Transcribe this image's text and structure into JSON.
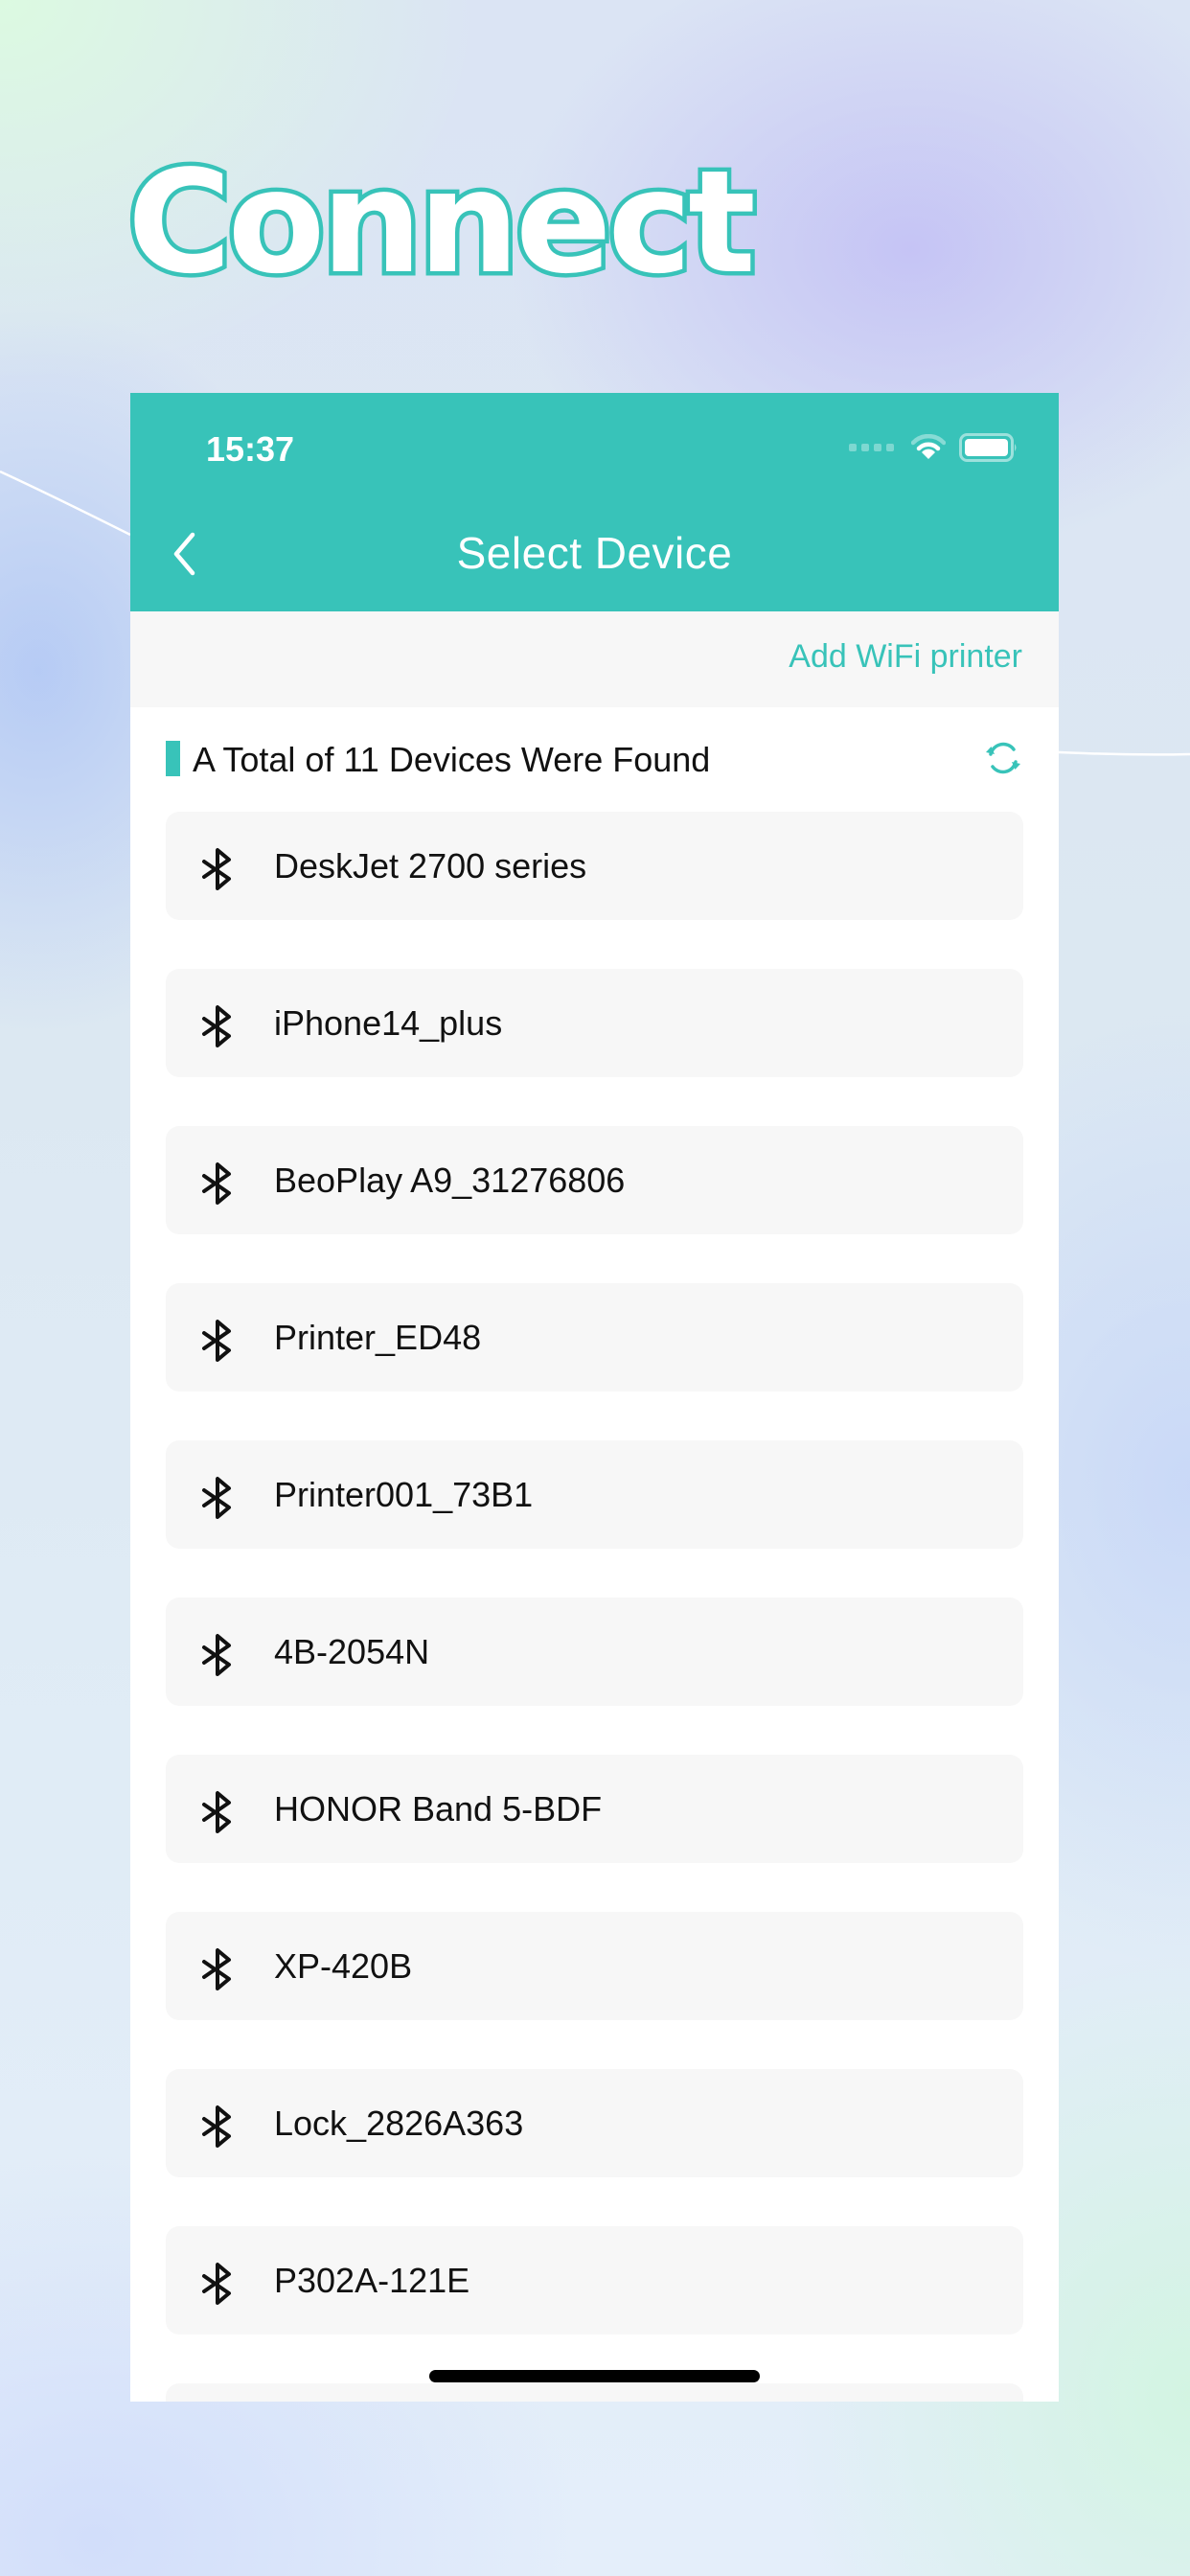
{
  "headline": "Connect",
  "status_bar": {
    "time": "15:37",
    "icons": [
      "signal-dots-icon",
      "wifi-icon",
      "battery-icon"
    ]
  },
  "nav": {
    "back_icon": "chevron-left-icon",
    "title": "Select Device"
  },
  "actions": {
    "add_wifi_label": "Add WiFi printer"
  },
  "section": {
    "title": "A Total of 11 Devices Were Found",
    "refresh_icon": "refresh-icon"
  },
  "devices": [
    {
      "name": "DeskJet 2700 series",
      "icon": "bluetooth-icon"
    },
    {
      "name": "iPhone14_plus",
      "icon": "bluetooth-icon"
    },
    {
      "name": "BeoPlay A9_31276806",
      "icon": "bluetooth-icon"
    },
    {
      "name": "Printer_ED48",
      "icon": "bluetooth-icon"
    },
    {
      "name": "Printer001_73B1",
      "icon": "bluetooth-icon"
    },
    {
      "name": "4B-2054N",
      "icon": "bluetooth-icon"
    },
    {
      "name": "HONOR Band 5-BDF",
      "icon": "bluetooth-icon"
    },
    {
      "name": "XP-420B",
      "icon": "bluetooth-icon"
    },
    {
      "name": "Lock_2826A363",
      "icon": "bluetooth-icon"
    },
    {
      "name": "P302A-121E",
      "icon": "bluetooth-icon"
    },
    {
      "name": "",
      "icon": ""
    }
  ],
  "colors": {
    "accent": "#38c3b9",
    "card_bg": "#f7f7f7",
    "text": "#111111"
  }
}
